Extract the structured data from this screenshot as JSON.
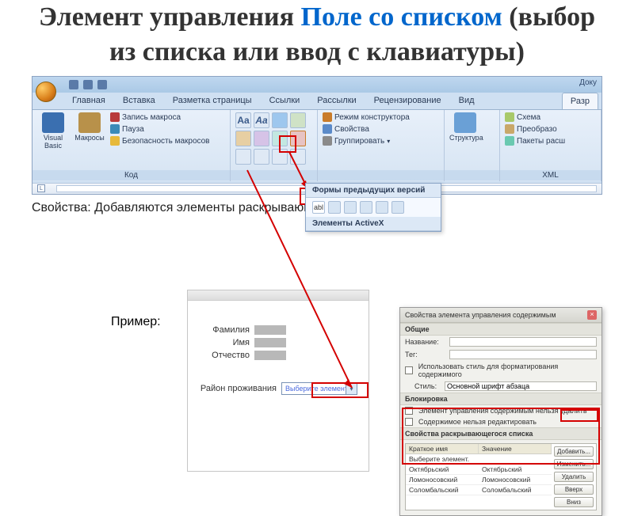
{
  "title": {
    "part1": "Элемент управления",
    "highlight": "Поле со списком",
    "part2": "(выбор из списка или ввод с клавиатуры)"
  },
  "qat": {
    "doc_hint": "Доку"
  },
  "tabs": {
    "items": [
      "Главная",
      "Вставка",
      "Разметка страницы",
      "Ссылки",
      "Рассылки",
      "Рецензирование",
      "Вид",
      "Разр"
    ]
  },
  "groups": {
    "code": {
      "vb": "Visual Basic",
      "macros": "Макросы",
      "record": "Запись макроса",
      "pause": "Пауза",
      "security": "Безопасность макросов",
      "label": "Код"
    },
    "controls": {
      "design": "Режим конструктора",
      "props": "Свойства",
      "group": "Группировать"
    },
    "structure": {
      "btn": "Структура",
      "schema": "Схема",
      "transform": "Преобразо",
      "expansion": "Пакеты расш",
      "label": "XML"
    }
  },
  "dropdown": {
    "legacy": "Формы предыдущих версий",
    "activex": "Элементы ActiveX",
    "abl": "abl"
  },
  "caption": "Свойства: Добавляются  элементы раскрывающегося списка",
  "example_label": "Пример:",
  "form": {
    "lastname": "Фамилия",
    "firstname": "Имя",
    "patronymic": "Отчество",
    "region": "Район проживания",
    "combo_placeholder": "Выберите элемент."
  },
  "props": {
    "title": "Свойства элемента управления содержимым",
    "general": "Общие",
    "name": "Название:",
    "tag": "Тег:",
    "use_style": "Использовать стиль для форматирования содержимого",
    "style": "Стиль:",
    "style_value": "Основной шрифт абзаца",
    "lock": "Блокировка",
    "no_delete": "Элемент управления содержимым нельзя удалить",
    "no_edit": "Содержимое нельзя редактировать",
    "dropdown_props": "Свойства раскрывающегося списка",
    "col_short": "Краткое имя",
    "col_value": "Значение",
    "rows": [
      [
        "Выберите элемент.",
        ""
      ],
      [
        "Октябрьский",
        "Октябрьский"
      ],
      [
        "Ломоносовский",
        "Ломоносовский"
      ],
      [
        "Соломбальский",
        "Соломбальский"
      ]
    ],
    "btn_add": "Добавить...",
    "btn_edit": "Изменить...",
    "btn_del": "Удалить",
    "btn_up": "Вверх",
    "btn_down": "Вниз"
  }
}
